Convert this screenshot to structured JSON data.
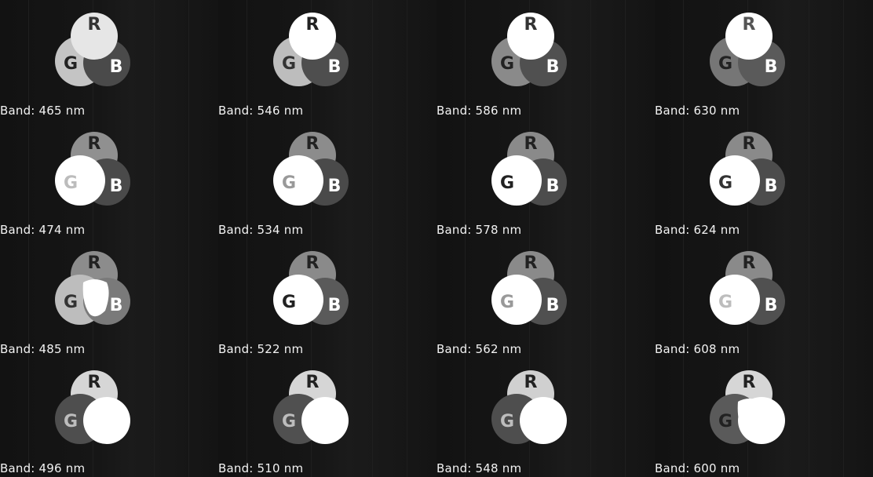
{
  "image_description": "",
  "tiles": [
    {
      "label": "Band: 465 nm",
      "r": "#e6e6e6",
      "g": "#c4c4c4",
      "b": "#4a4a4a",
      "front": "r",
      "lr": "#333",
      "lg": "#222",
      "lb": "#ffffff"
    },
    {
      "label": "Band: 546 nm",
      "r": "#ffffff",
      "g": "#bdbdbd",
      "b": "#4e4e4e",
      "front": "r",
      "lr": "#222",
      "lg": "#333",
      "lb": "#ffffff"
    },
    {
      "label": "Band: 586 nm",
      "r": "#ffffff",
      "g": "#8a8a8a",
      "b": "#505050",
      "front": "r",
      "lr": "#333",
      "lg": "#222",
      "lb": "#ffffff"
    },
    {
      "label": "Band: 630 nm",
      "r": "#ffffff",
      "g": "#767676",
      "b": "#5a5a5a",
      "front": "r",
      "lr": "#555",
      "lg": "#222",
      "lb": "#ffffff"
    },
    {
      "label": "Band: 474 nm",
      "r": "#909090",
      "g": "#ffffff",
      "b": "#4a4a4a",
      "front": "g",
      "lr": "#222",
      "lg": "#bcbcbc",
      "lb": "#ffffff"
    },
    {
      "label": "Band: 534 nm",
      "r": "#8c8c8c",
      "g": "#ffffff",
      "b": "#4a4a4a",
      "front": "g",
      "lr": "#222",
      "lg": "#999",
      "lb": "#ffffff"
    },
    {
      "label": "Band: 578 nm",
      "r": "#8a8a8a",
      "g": "#ffffff",
      "b": "#4c4c4c",
      "front": "g",
      "lr": "#222",
      "lg": "#222",
      "lb": "#ffffff"
    },
    {
      "label": "Band: 624 nm",
      "r": "#8a8a8a",
      "g": "#ffffff",
      "b": "#4c4c4c",
      "front": "g",
      "lr": "#222",
      "lg": "#333",
      "lb": "#ffffff"
    },
    {
      "label": "Band: 485 nm",
      "r": "#8c8c8c",
      "g": "#bdbdbd",
      "b": "#7a7a7a",
      "front": "rgb",
      "lr": "#222",
      "lg": "#333",
      "lb": "#ffffff"
    },
    {
      "label": "Band: 522 nm",
      "r": "#8a8a8a",
      "g": "#ffffff",
      "b": "#5a5a5a",
      "front": "g",
      "lr": "#222",
      "lg": "#222",
      "lb": "#ffffff"
    },
    {
      "label": "Band: 562 nm",
      "r": "#8a8a8a",
      "g": "#ffffff",
      "b": "#505050",
      "front": "g",
      "lr": "#222",
      "lg": "#999",
      "lb": "#ffffff"
    },
    {
      "label": "Band: 608 nm",
      "r": "#8a8a8a",
      "g": "#ffffff",
      "b": "#505050",
      "front": "g",
      "lr": "#222",
      "lg": "#bdbdbd",
      "lb": "#ffffff"
    },
    {
      "label": "Band: 496 nm",
      "r": "#d6d6d6",
      "g": "#4e4e4e",
      "b": "#ffffff",
      "front": "b",
      "lr": "#222",
      "lg": "#bdbdbd",
      "lb": "#ffffff"
    },
    {
      "label": "Band: 510 nm",
      "r": "#d6d6d6",
      "g": "#505050",
      "b": "#ffffff",
      "front": "b",
      "lr": "#222",
      "lg": "#bdbdbd",
      "lb": "#ffffff"
    },
    {
      "label": "Band: 548 nm",
      "r": "#d0d0d0",
      "g": "#4e4e4e",
      "b": "#ffffff",
      "front": "b",
      "lr": "#222",
      "lg": "#bdbdbd",
      "lb": "#ffffff"
    },
    {
      "label": "Band: 600 nm",
      "r": "#d6d6d6",
      "g": "#5a5a5a",
      "b": "#ffffff",
      "front": "rgb",
      "lr": "#222",
      "lg": "#222",
      "lb": "#ffffff"
    }
  ],
  "letters": {
    "r": "R",
    "g": "G",
    "b": "B"
  }
}
